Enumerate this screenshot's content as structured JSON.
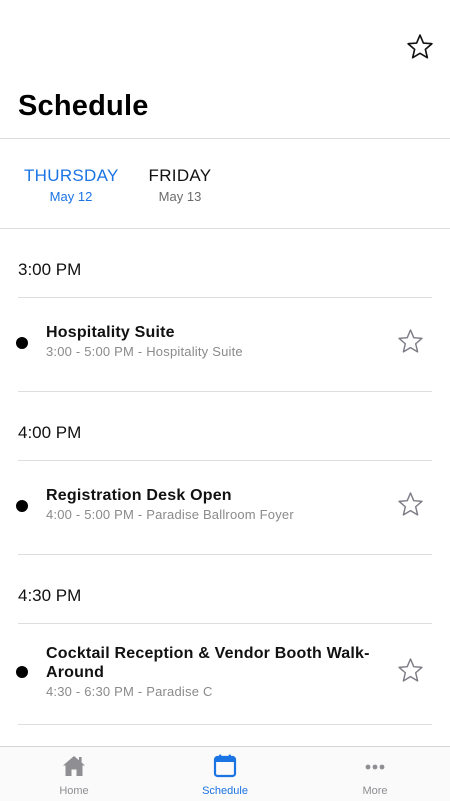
{
  "header": {
    "title": "Schedule",
    "favorite_icon": "star-outline-icon"
  },
  "day_tabs": [
    {
      "day": "THURSDAY",
      "date": "May 12",
      "active": true
    },
    {
      "day": "FRIDAY",
      "date": "May 13",
      "active": false
    }
  ],
  "time_groups": [
    {
      "time": "3:00 PM",
      "sessions": [
        {
          "title": "Hospitality Suite",
          "subtitle": "3:00 - 5:00 PM - Hospitality Suite",
          "starred": false
        }
      ]
    },
    {
      "time": "4:00 PM",
      "sessions": [
        {
          "title": "Registration Desk Open",
          "subtitle": "4:00 - 5:00 PM - Paradise Ballroom Foyer",
          "starred": false
        }
      ]
    },
    {
      "time": "4:30 PM",
      "sessions": [
        {
          "title": "Cocktail Reception & Vendor Booth Walk-Around",
          "subtitle": "4:30 - 6:30 PM - Paradise C",
          "starred": false
        }
      ]
    }
  ],
  "tab_bar": [
    {
      "label": "Home",
      "icon": "home-icon",
      "active": false
    },
    {
      "label": "Schedule",
      "icon": "calendar-icon",
      "active": true
    },
    {
      "label": "More",
      "icon": "more-dots-icon",
      "active": false
    }
  ],
  "colors": {
    "accent": "#1b74e4",
    "inactive": "#8e8e93",
    "divider": "#dedede",
    "subtitle": "#8a8a8a"
  }
}
